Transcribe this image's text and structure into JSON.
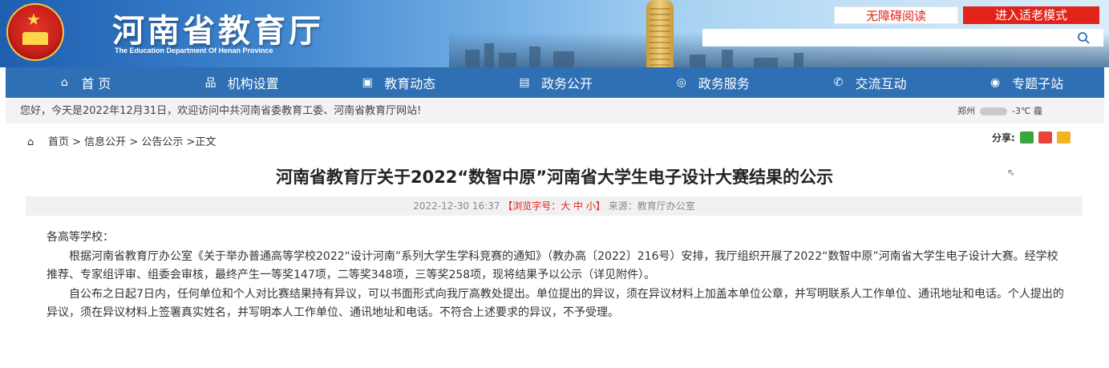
{
  "header": {
    "site_title": "河南省教育厅",
    "site_subtitle": "The Education Department Of Henan Province",
    "accessibility_label": "无障碍阅读",
    "elder_mode_label": "进入适老模式",
    "search_placeholder": ""
  },
  "nav": {
    "items": [
      {
        "label": "首 页",
        "icon": "home-icon"
      },
      {
        "label": "机构设置",
        "icon": "org-chart-icon"
      },
      {
        "label": "教育动态",
        "icon": "news-icon"
      },
      {
        "label": "政务公开",
        "icon": "document-icon"
      },
      {
        "label": "政务服务",
        "icon": "service-icon"
      },
      {
        "label": "交流互动",
        "icon": "chat-icon"
      },
      {
        "label": "专题子站",
        "icon": "target-icon"
      }
    ]
  },
  "greeting": {
    "text": "您好，今天是2022年12月31日，欢迎访问中共河南省委教育工委、河南省教育厅网站!",
    "weather_city": "郑州",
    "weather_temp": "-3℃ 霾"
  },
  "breadcrumb": {
    "home": "首页",
    "path": "> 信息公开 > 公告公示 >正文"
  },
  "share": {
    "label": "分享:",
    "icons": [
      "wechat-icon",
      "weibo-icon",
      "qq-icon"
    ]
  },
  "article": {
    "title": "河南省教育厅关于2022“数智中原”河南省大学生电子设计大赛结果的公示",
    "date": "2022-12-30 16:37",
    "font_size_label": "【浏览字号：大 中 小】",
    "source": "来源：教育厅办公室",
    "salutation": "各高等学校：",
    "paragraphs": [
      "根据河南省教育厅办公室《关于举办普通高等学校2022“设计河南”系列大学生学科竞赛的通知》（教办高〔2022〕216号）安排，我厅组织开展了2022“数智中原”河南省大学生电子设计大赛。经学校推荐、专家组评审、组委会审核，最终产生一等奖147项，二等奖348项，三等奖258项，现将结果予以公示（详见附件）。",
      "自公布之日起7日内，任何单位和个人对比赛结果持有异议，可以书面形式向我厅高教处提出。单位提出的异议，须在异议材料上加盖本单位公章，并写明联系人工作单位、通讯地址和电话。个人提出的异议，须在异议材料上签署真实姓名，并写明本人工作单位、通讯地址和电话。不符合上述要求的异议，不予受理。"
    ]
  }
}
